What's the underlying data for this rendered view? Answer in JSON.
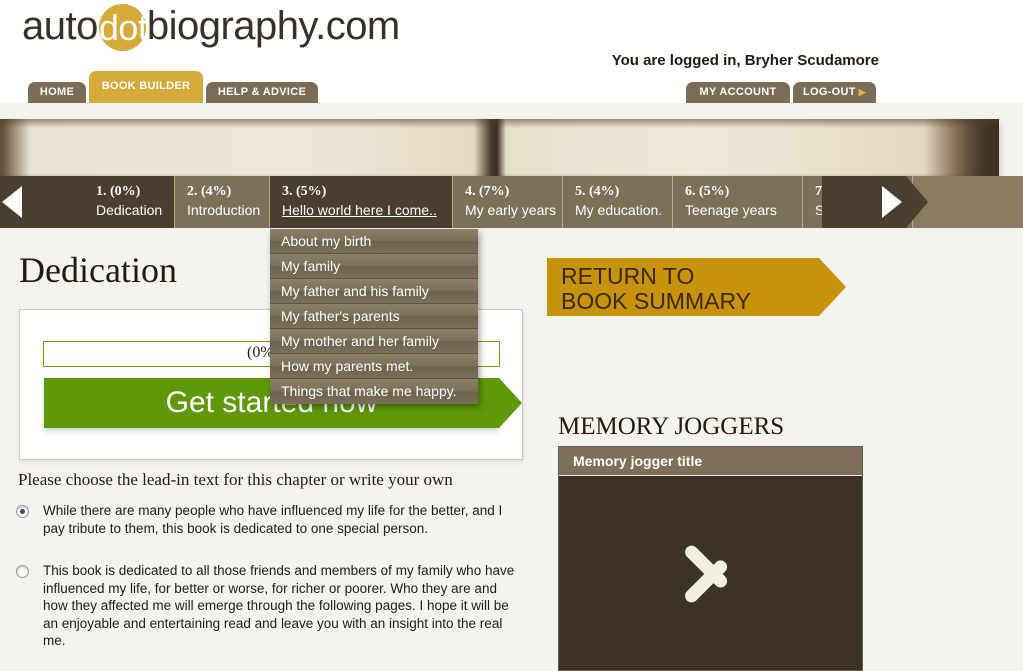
{
  "brand": {
    "part1": "auto",
    "dot": "dot",
    "part2": "biography.com"
  },
  "account": {
    "status": "You are logged in, Bryher Scudamore",
    "my_account_label": "MY ACCOUNT",
    "logout_label": "LOG-OUT"
  },
  "nav": {
    "home": "HOME",
    "book_builder": "BOOK BUILDER",
    "help": "HELP & ADVICE"
  },
  "chapters": [
    {
      "num": "1.",
      "pct": "(0%)",
      "name": "Dedication"
    },
    {
      "num": "2.",
      "pct": "(4%)",
      "name": "Introduction"
    },
    {
      "num": "3.",
      "pct": "(5%)",
      "name": "Hello world here I come.."
    },
    {
      "num": "4.",
      "pct": "(7%)",
      "name": "My early years"
    },
    {
      "num": "5.",
      "pct": "(4%)",
      "name": "My education."
    },
    {
      "num": "6.",
      "pct": "(5%)",
      "name": "Teenage years"
    },
    {
      "num": "7.",
      "pct": "",
      "name": "Sta"
    }
  ],
  "dropdown": {
    "items": [
      "About my birth",
      "My family",
      "My father and his family",
      "My father's parents",
      "My mother and her family",
      "How my parents met.",
      "Things that make me happy."
    ]
  },
  "main": {
    "page_title": "Dedication",
    "chapter_title_value": "",
    "chapter_title_placeholder": "",
    "percent_note": "(0%",
    "get_started_label": "Get started now",
    "return_summary_line1": "RETURN TO",
    "return_summary_line2": "BOOK SUMMARY",
    "lead_in_question": "Please choose the lead-in text for this chapter or write your own",
    "options": [
      {
        "selected": true,
        "text": "While there are many people who have influenced my life for the better, and I pay tribute to them, this book is dedicated to one special person."
      },
      {
        "selected": false,
        "text": "This book is dedicated to all those friends and members of my family who have influenced my life, for better or worse, for richer or poorer. Who they are and how they affected me will emerge through the following pages. I hope it will be an enjoyable and entertaining read and leave you with an insight into the real me."
      }
    ]
  },
  "memory_joggers": {
    "heading": "MEMORY JOGGERS",
    "panel_title": "Memory jogger title"
  },
  "colors": {
    "gold": "#d5a93a",
    "brown_dark": "#4b3e2e",
    "brown_light": "#7d7058",
    "green": "#5f9808",
    "page_bg": "#f4f3ed"
  }
}
